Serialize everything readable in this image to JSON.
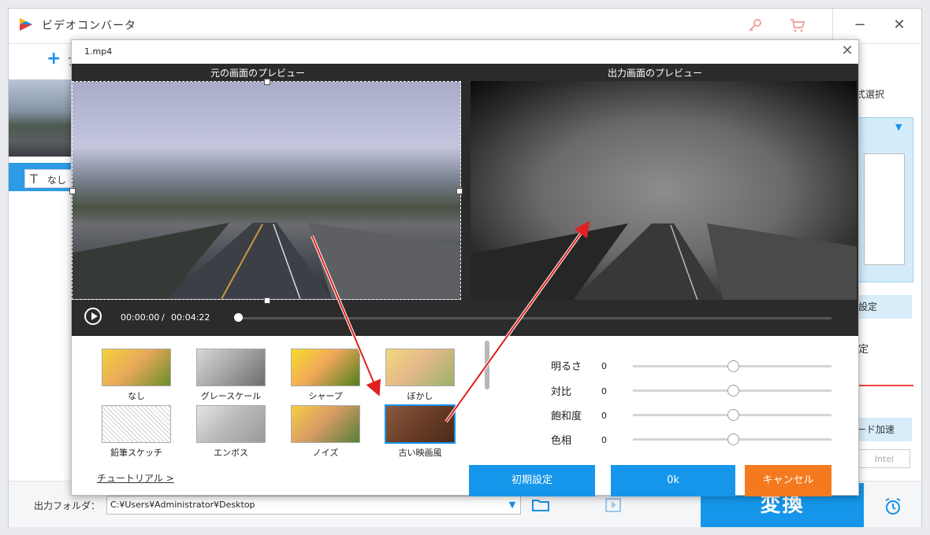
{
  "app": {
    "title": "ビデオコンバータ",
    "add_label": "フ"
  },
  "colors": {
    "accent": "#1596ea",
    "cancel": "#f57a1f",
    "arrow": "#e02020"
  },
  "left_panel": {
    "text_option": "なし"
  },
  "right_panel": {
    "format_label": "式選択",
    "settings_label": "設定",
    "label2": "定",
    "hw_label": "ード加速",
    "intel": "Intel"
  },
  "bottom": {
    "output_label": "出力フォルダ：",
    "output_path": "C:¥Users¥Administrator¥Desktop",
    "convert": "変換"
  },
  "dialog": {
    "title": "1.mp4",
    "source_preview": "元の画面のプレビュー",
    "output_preview": "出力画面のプレビュー",
    "time_current": "00:00:00",
    "time_separator": "/",
    "time_total": "00:04:22",
    "filters": [
      {
        "label": "なし",
        "selected": false
      },
      {
        "label": "グレースケール",
        "selected": false
      },
      {
        "label": "シャープ",
        "selected": false
      },
      {
        "label": "ぼかし",
        "selected": false
      },
      {
        "label": "鉛筆スケッチ",
        "selected": false
      },
      {
        "label": "エンボス",
        "selected": false
      },
      {
        "label": "ノイズ",
        "selected": false
      },
      {
        "label": "古い映画風",
        "selected": true
      }
    ],
    "adjustments": [
      {
        "label": "明るさ",
        "value": "0"
      },
      {
        "label": "対比",
        "value": "0"
      },
      {
        "label": "飽和度",
        "value": "0"
      },
      {
        "label": "色相",
        "value": "0"
      }
    ],
    "tutorial": "チュートリアル >",
    "buttons": {
      "reset": "初期設定",
      "ok": "0k",
      "cancel": "キャンセル"
    }
  }
}
